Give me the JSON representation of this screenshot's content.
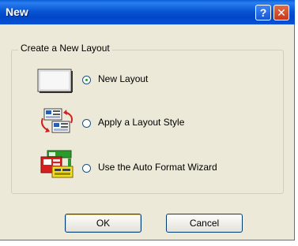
{
  "window": {
    "title": "New"
  },
  "titlebar": {
    "help_label": "?",
    "close_label": "✕"
  },
  "group": {
    "label": "Create a New Layout",
    "options": [
      {
        "label": "New Layout",
        "selected": true,
        "icon": "blank-layout-icon"
      },
      {
        "label": "Apply a Layout Style",
        "selected": false,
        "icon": "layout-style-icon"
      },
      {
        "label": "Use the Auto Format Wizard",
        "selected": false,
        "icon": "format-wizard-icon"
      }
    ]
  },
  "buttons": {
    "ok": "OK",
    "cancel": "Cancel"
  }
}
